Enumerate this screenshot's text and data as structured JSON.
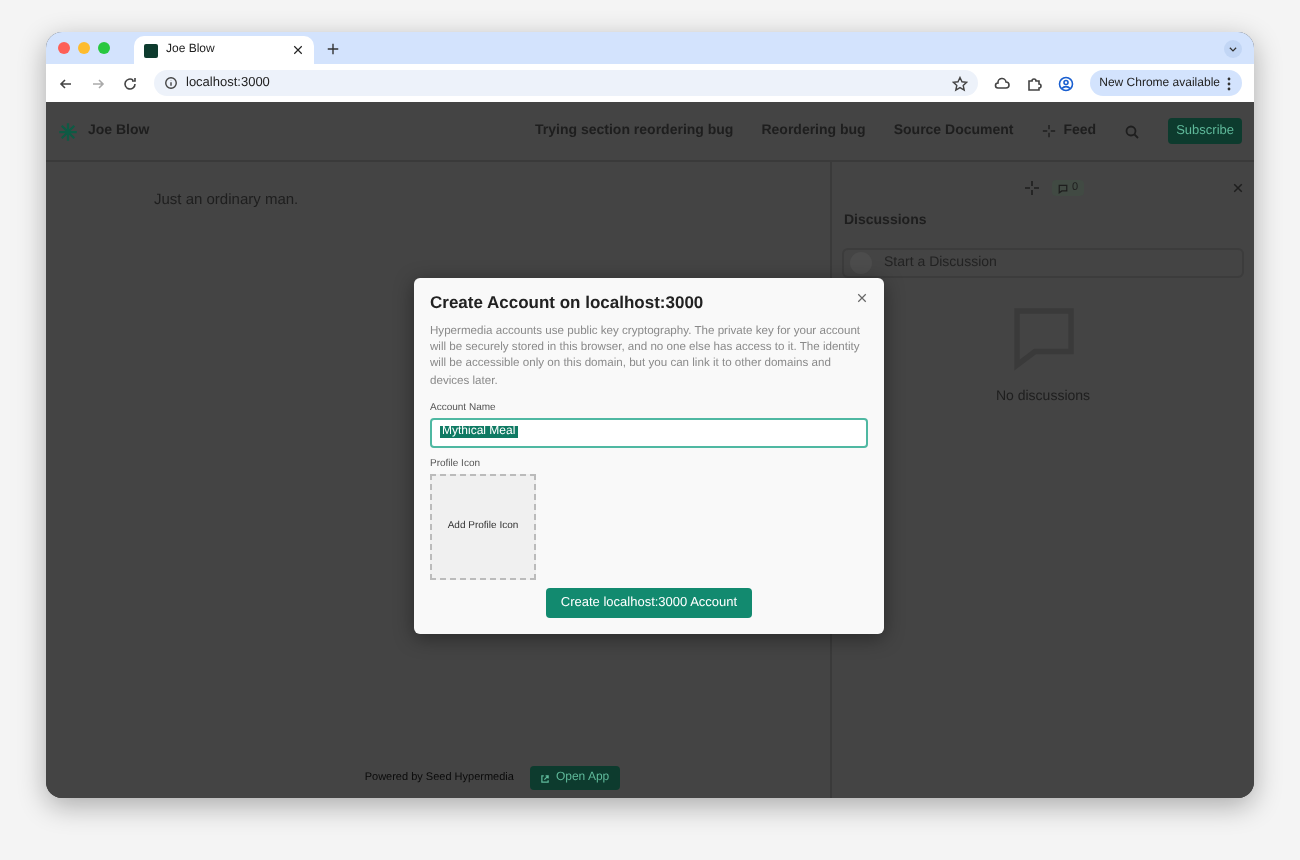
{
  "browser": {
    "tab_title": "Joe Blow",
    "address": "localhost:3000",
    "update_button": "New Chrome available"
  },
  "site": {
    "brand": "Joe Blow",
    "nav": [
      "Trying section reordering bug",
      "Reordering bug",
      "Source Document"
    ],
    "feed": "Feed",
    "subscribe": "Subscribe"
  },
  "content": {
    "text": "Just an ordinary man."
  },
  "discussions": {
    "count": "0",
    "title": "Discussions",
    "placeholder": "Start a Discussion",
    "empty": "No discussions"
  },
  "footer": {
    "powered_by": "Powered by Seed Hypermedia",
    "open_app": "Open App"
  },
  "modal": {
    "title": "Create Account on localhost:3000",
    "description": "Hypermedia accounts use public key cryptography. The private key for your account will be securely stored in this browser, and no one else has access to it. The identity will be accessible only on this domain, but you can link it to other domains and devices later.",
    "account_name_label": "Account Name",
    "account_name_value": "Mythical Meal",
    "value_selected": true,
    "profile_icon_label": "Profile Icon",
    "add_profile_icon": "Add Profile Icon",
    "submit": "Create localhost:3000 Account"
  }
}
